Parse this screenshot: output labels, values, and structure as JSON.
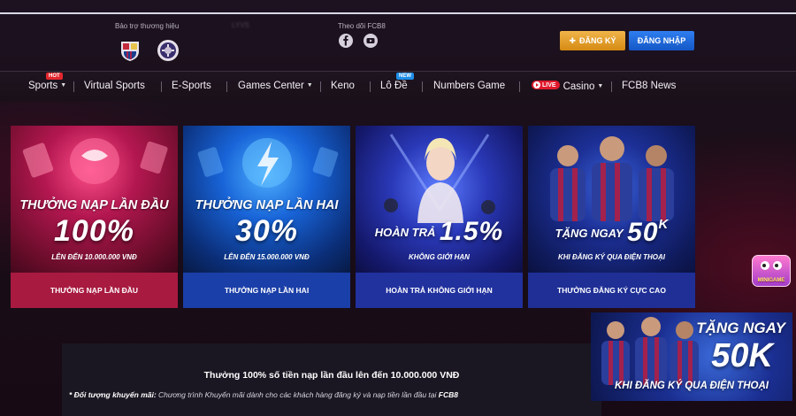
{
  "header": {
    "sponsor_label": "Bảo trợ thương hiệu",
    "blurred_text": "LYVS",
    "follow_label": "Theo dõi FCB8",
    "register_label": "ĐĂNG KÝ",
    "register_icon": "plus-icon",
    "login_label": "ĐĂNG NHẬP"
  },
  "nav": {
    "items": [
      {
        "label": "Sports",
        "dropdown": true,
        "badge": "HOT"
      },
      {
        "label": "Virtual Sports"
      },
      {
        "label": "E-Sports"
      },
      {
        "label": "Games Center",
        "dropdown": true
      },
      {
        "label": "Keno"
      },
      {
        "label": "Lô Đề",
        "badge": "NEW"
      },
      {
        "label": "Numbers Game"
      },
      {
        "label": "Casino",
        "dropdown": true,
        "live": "LIVE"
      },
      {
        "label": "FCB8 News"
      }
    ]
  },
  "promos": [
    {
      "title": "THƯỞNG NẠP LẦN ĐẦU",
      "value": "100%",
      "subtitle": "LÊN ĐẾN 10.000.000 VNĐ",
      "footer": "THƯỞNG NẠP LẦN ĐẦU"
    },
    {
      "title": "THƯỞNG NẠP LẦN HAI",
      "value": "30%",
      "subtitle": "LÊN ĐẾN 15.000.000 VNĐ",
      "footer": "THƯỞNG NẠP LẦN HAI"
    },
    {
      "title": "HOÀN TRẢ",
      "value": "1.5%",
      "subtitle": "KHÔNG GIỚI HẠN",
      "footer": "HOÀN TRẢ KHÔNG GIỚI HẠN"
    },
    {
      "title": "TẶNG NGAY",
      "value": "50",
      "value_suffix": "K",
      "subtitle": "KHI ĐĂNG KÝ QUA ĐIỆN THOẠI",
      "footer": "THƯỞNG ĐĂNG KÝ CỰC CAO"
    }
  ],
  "info": {
    "main": "Thưởng 100% số tiền nạp lần đầu lên đến 10.000.000 VNĐ",
    "note_prefix": "* Đối tượng khuyến mãi:",
    "note_text": " Chương trình Khuyến mãi dành cho các khách hàng đăng ký và nạp tiền lần đầu tại ",
    "note_brand": "FCB8"
  },
  "minigame_label": "MINIGAME",
  "float_ad": {
    "line1": "TẶNG NGAY",
    "line2": "50K",
    "line3": "KHI ĐĂNG KÝ QUA ĐIỆN THOẠI"
  },
  "colors": {
    "register": "#e19a20",
    "login": "#1e67dc",
    "hot_badge": "#e4262d",
    "new_badge": "#1f8ee8",
    "live_badge": "#e0192b"
  }
}
